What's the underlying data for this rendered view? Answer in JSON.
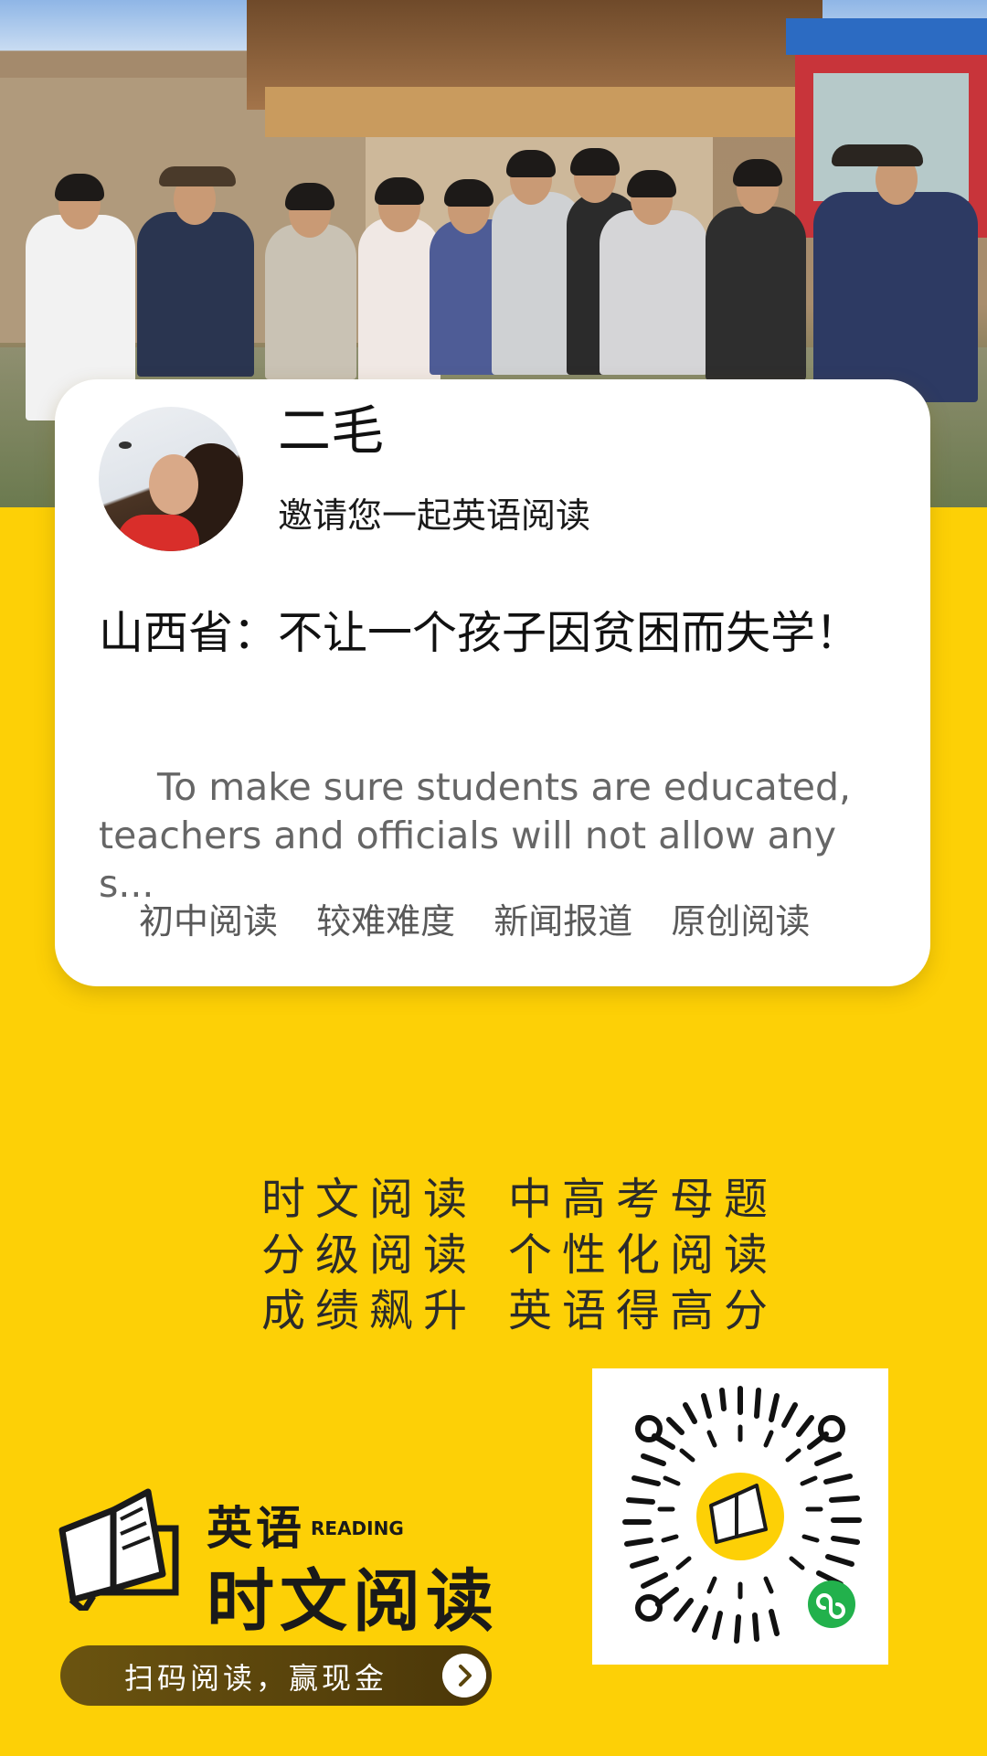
{
  "card": {
    "user_name": "二毛",
    "invite_text": "邀请您一起英语阅读",
    "article_title": "山西省：不让一个孩子因贫困而失学！",
    "summary": "To make sure students are educated, teachers and officials will not allow any s...",
    "tags": [
      "初中阅读",
      "较难难度",
      "新闻报道",
      "原创阅读"
    ]
  },
  "slogans": [
    [
      "时文阅读",
      "中高考母题"
    ],
    [
      "分级阅读",
      "个性化阅读"
    ],
    [
      "成绩飙升",
      "英语得高分"
    ]
  ],
  "logo": {
    "line1": "英语",
    "reading": "READING",
    "line2": "时文阅读"
  },
  "cta": {
    "label": "扫码阅读，赢现金",
    "icon": "chevron-right-icon"
  },
  "qr": {
    "center_icon": "book-icon",
    "badge_icon": "mini-program-icon"
  },
  "colors": {
    "background": "#fdd006",
    "card": "#ffffff",
    "cta": "#5a450c",
    "badge": "#22b14c"
  }
}
